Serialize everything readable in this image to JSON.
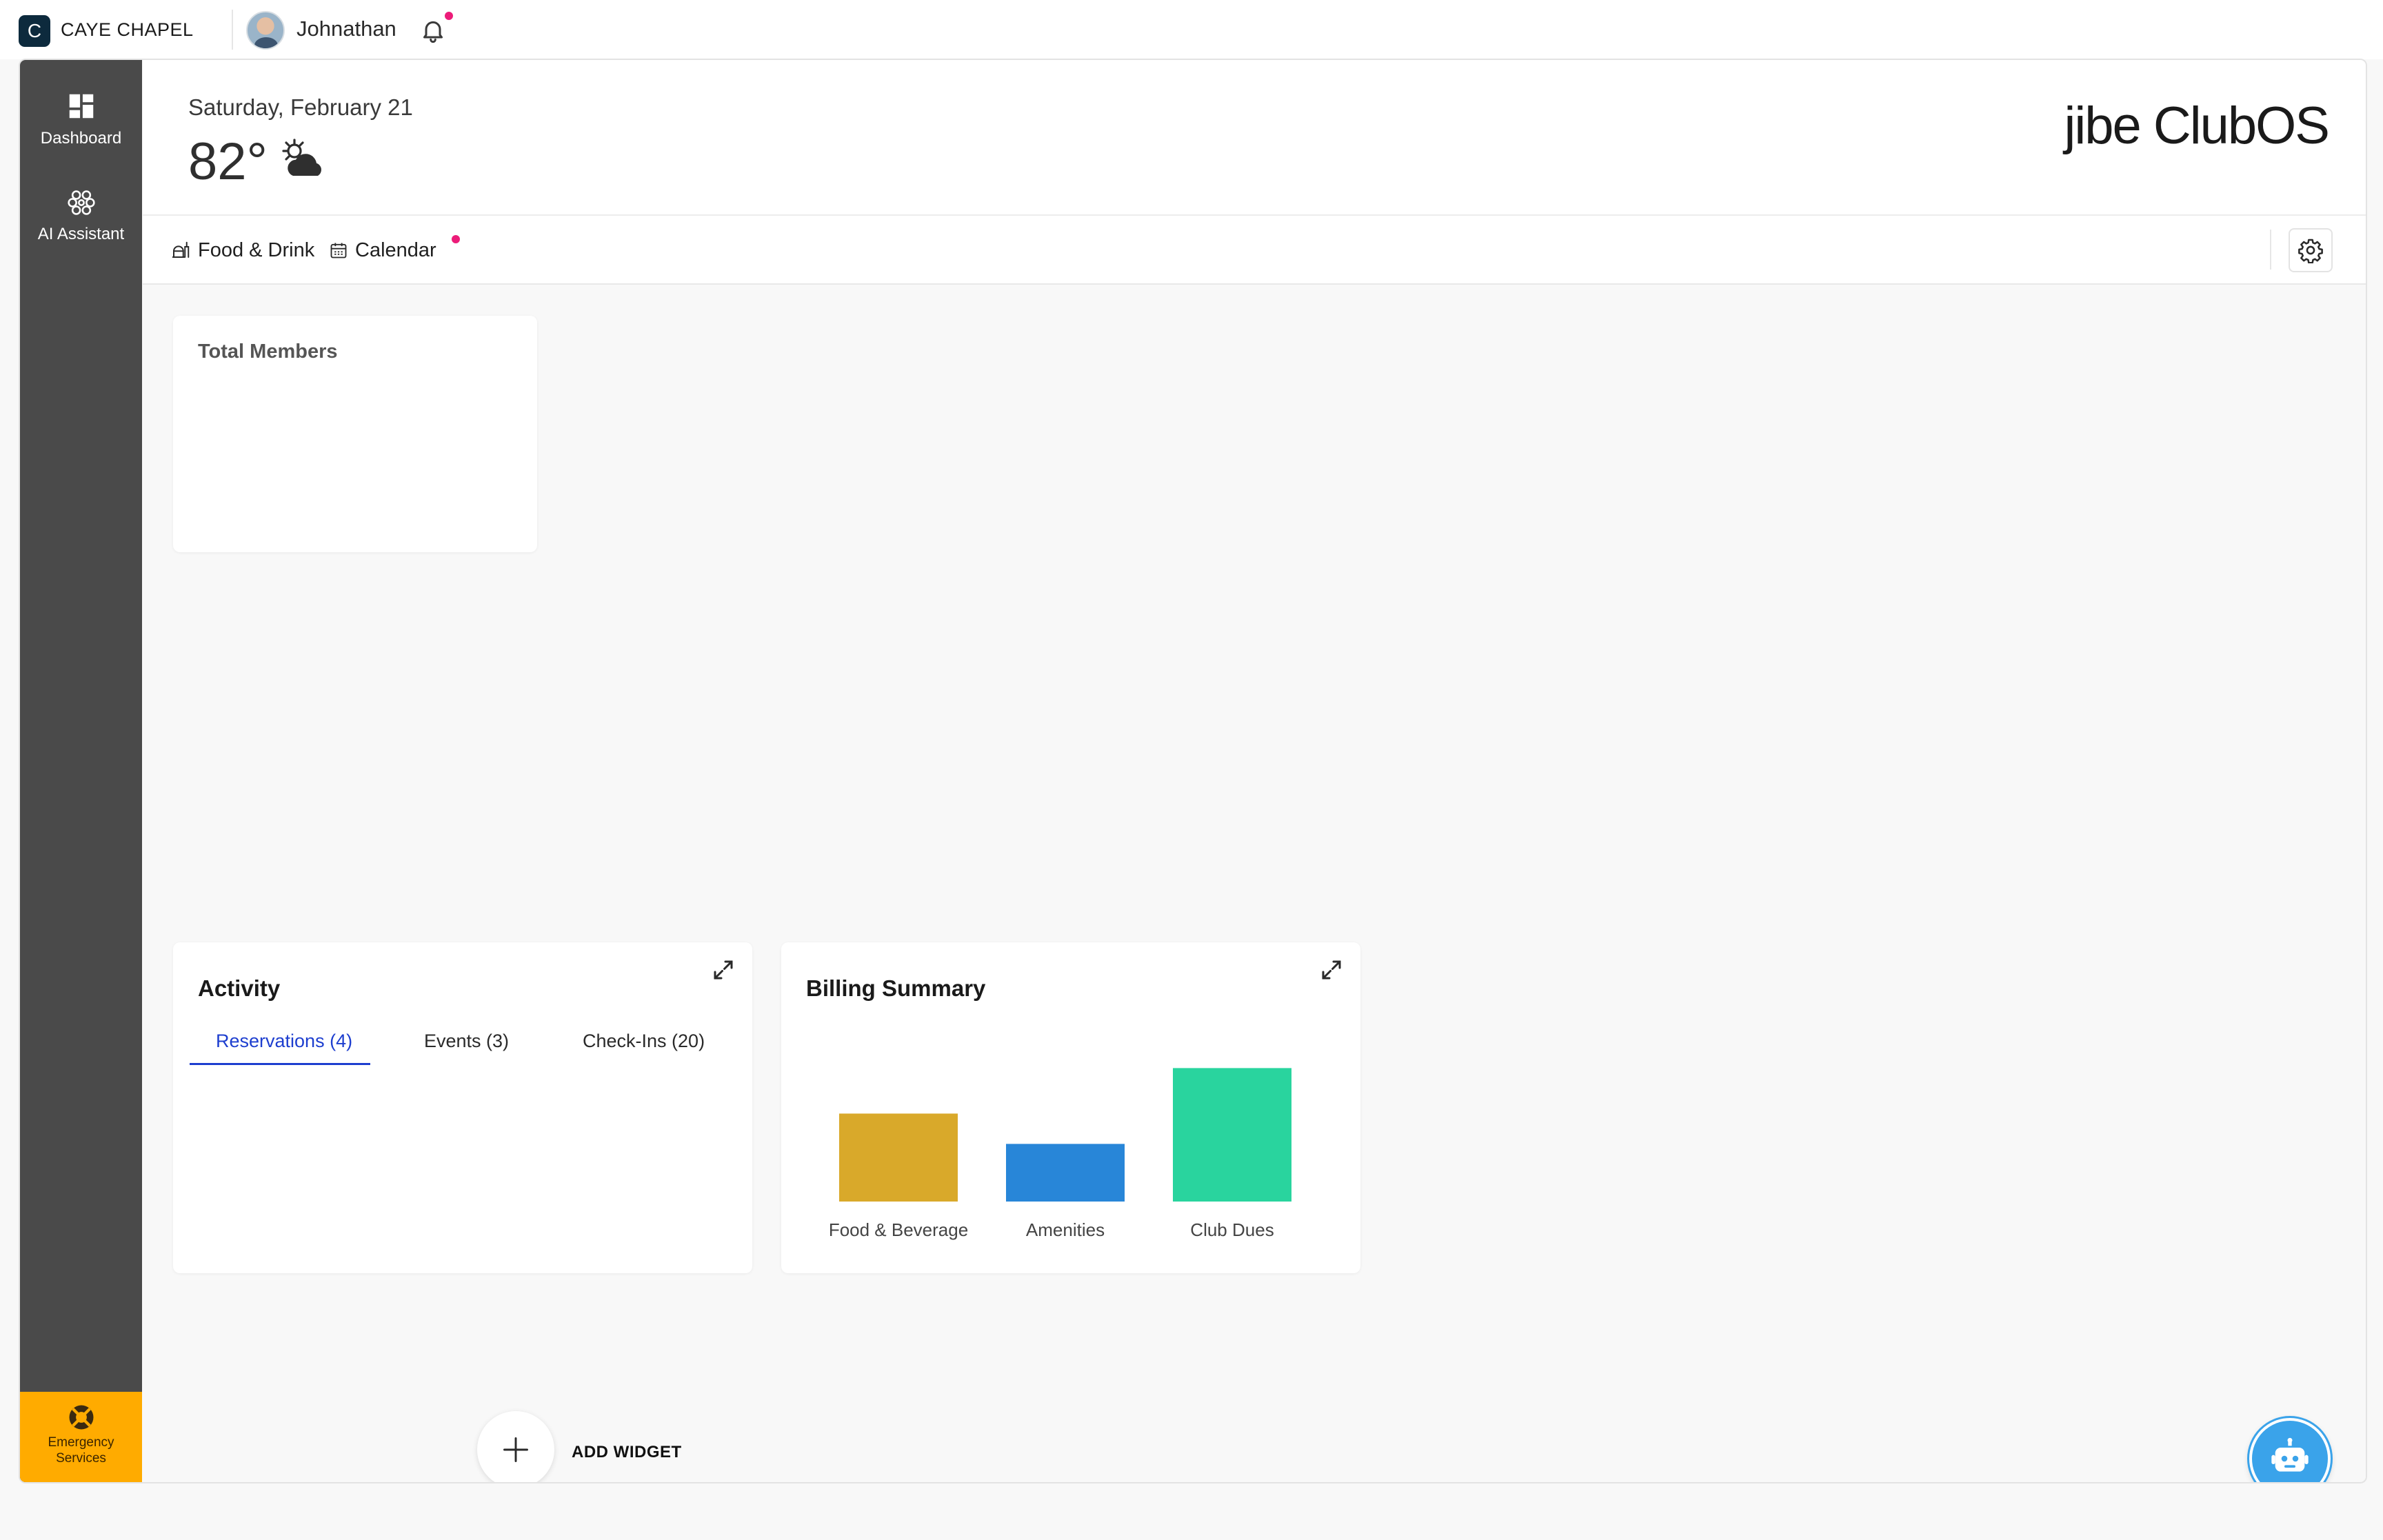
{
  "topbar": {
    "club_initial": "C",
    "club_name": "CAYE CHAPEL",
    "user_name": "Johnathan",
    "notification_dot_color": "#ec1c79"
  },
  "sidebar": {
    "items": [
      {
        "label": "Dashboard",
        "icon": "dashboard-icon"
      },
      {
        "label": "AI Assistant",
        "icon": "ai-assistant-icon"
      }
    ],
    "emergency": {
      "line1": "Emergency",
      "line2": "Services",
      "icon": "lifebuoy-icon",
      "color": "#ffab00"
    }
  },
  "header": {
    "date": "Saturday, February 21",
    "temperature": "82°",
    "weather_icon": "partly-cloudy-icon",
    "brand_prefix": "jibe",
    "brand_name": "ClubOS"
  },
  "tabs": [
    {
      "label": "Food & Drink",
      "icon": "food-drink-icon"
    },
    {
      "label": "Calendar",
      "icon": "calendar-icon"
    }
  ],
  "widgets": {
    "members": {
      "title": "Total Members"
    },
    "activity": {
      "title": "Activity",
      "tabs": [
        "Reservations (4)",
        "Events (3)",
        "Check-Ins (20)"
      ],
      "active_tab": "Reservations (4)",
      "accent": "#1d3ecf"
    },
    "billing": {
      "title": "Billing Summary"
    }
  },
  "chart_data": {
    "type": "bar",
    "categories": [
      "Food & Beverage",
      "Amenities",
      "Club Dues"
    ],
    "values": [
      58,
      38,
      88
    ],
    "colors": [
      "#d9a92a",
      "#2886d8",
      "#29d49e"
    ],
    "ylim": [
      0,
      100
    ],
    "grid": false
  },
  "actions": {
    "add_widget_label": "ADD WIDGET",
    "assistant_fab_icon": "robot-icon",
    "fab_color": "#3aa3ea"
  }
}
